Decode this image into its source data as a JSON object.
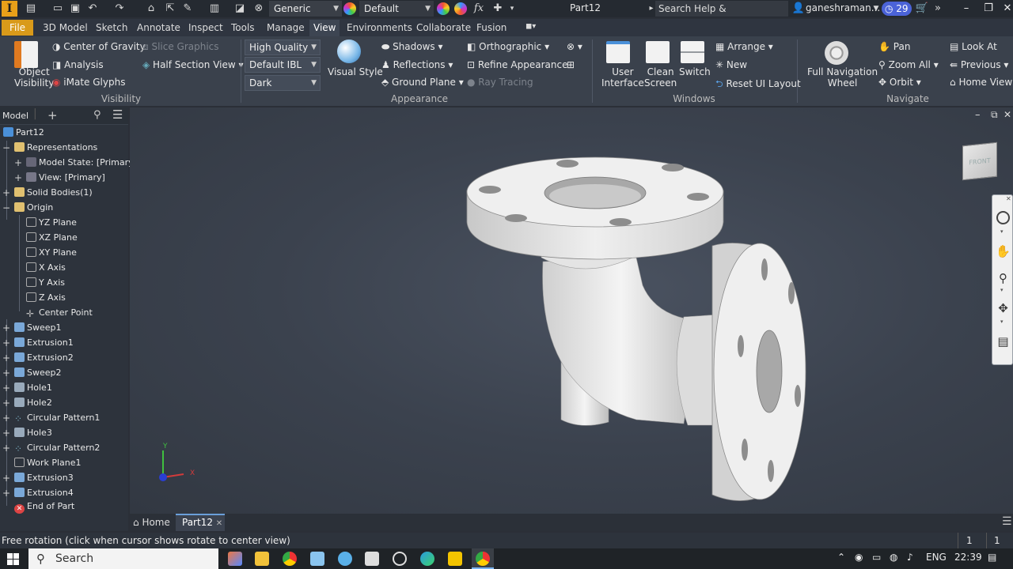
{
  "titlebar": {
    "logo": "I",
    "appearance_dropdown": "Generic",
    "material_dropdown": "Default",
    "fx_label": "fx",
    "doc_title": "Part12",
    "search_placeholder": "Search Help & Commands...",
    "user": "ganeshraman...",
    "badge": "29"
  },
  "menu": {
    "file": "File",
    "tabs": [
      "3D Model",
      "Sketch",
      "Annotate",
      "Inspect",
      "Tools",
      "Manage",
      "View",
      "Environments",
      "Collaborate",
      "Fusion"
    ]
  },
  "ribbon": {
    "visibility": {
      "title": "Visibility",
      "object_visibility": [
        "Object",
        "Visibility"
      ],
      "center_of_gravity": "Center of Gravity",
      "analysis": "Analysis",
      "imate_glyphs": "iMate Glyphs",
      "slice_graphics": "Slice Graphics",
      "half_section_view": "Half Section View"
    },
    "appearance": {
      "title": "Appearance",
      "quality": "High Quality",
      "ibl": "Default IBL",
      "theme": "Dark",
      "visual_style": "Visual Style",
      "shadows": "Shadows",
      "reflections": "Reflections",
      "ground_plane": "Ground Plane",
      "orthographic": "Orthographic",
      "refine_appearance": "Refine Appearance",
      "ray_tracing": "Ray Tracing"
    },
    "windows": {
      "title": "Windows",
      "user_interface": [
        "User",
        "Interface"
      ],
      "clean_screen": [
        "Clean",
        "Screen"
      ],
      "switch": "Switch",
      "arrange": "Arrange",
      "new": "New",
      "reset_ui_layout": "Reset UI Layout"
    },
    "navigate": {
      "title": "Navigate",
      "full_nav_wheel": [
        "Full Navigation",
        "Wheel"
      ],
      "pan": "Pan",
      "zoom_all": "Zoom All",
      "orbit": "Orbit",
      "look_at": "Look At",
      "previous": "Previous",
      "home_view": "Home View"
    }
  },
  "browser": {
    "tab": "Model",
    "tree": [
      "Part12",
      "Representations",
      "Model State: [Primary]",
      "View: [Primary]",
      "Solid Bodies(1)",
      "Origin",
      "YZ Plane",
      "XZ Plane",
      "XY Plane",
      "X Axis",
      "Y Axis",
      "Z Axis",
      "Center Point",
      "Sweep1",
      "Extrusion1",
      "Extrusion2",
      "Sweep2",
      "Hole1",
      "Hole2",
      "Circular Pattern1",
      "Hole3",
      "Circular Pattern2",
      "Work Plane1",
      "Extrusion3",
      "Extrusion4",
      "End of Part"
    ]
  },
  "viewcube": {
    "label": "FRONT"
  },
  "triad": {
    "x": "X",
    "y": "Y"
  },
  "doc_tabs": {
    "home": "Home",
    "part": "Part12"
  },
  "status": {
    "message": "Free rotation (click when cursor shows rotate to center view)",
    "count1": "1",
    "count2": "1"
  },
  "taskbar": {
    "search": "Search",
    "lang": "ENG",
    "time": "22:39"
  }
}
